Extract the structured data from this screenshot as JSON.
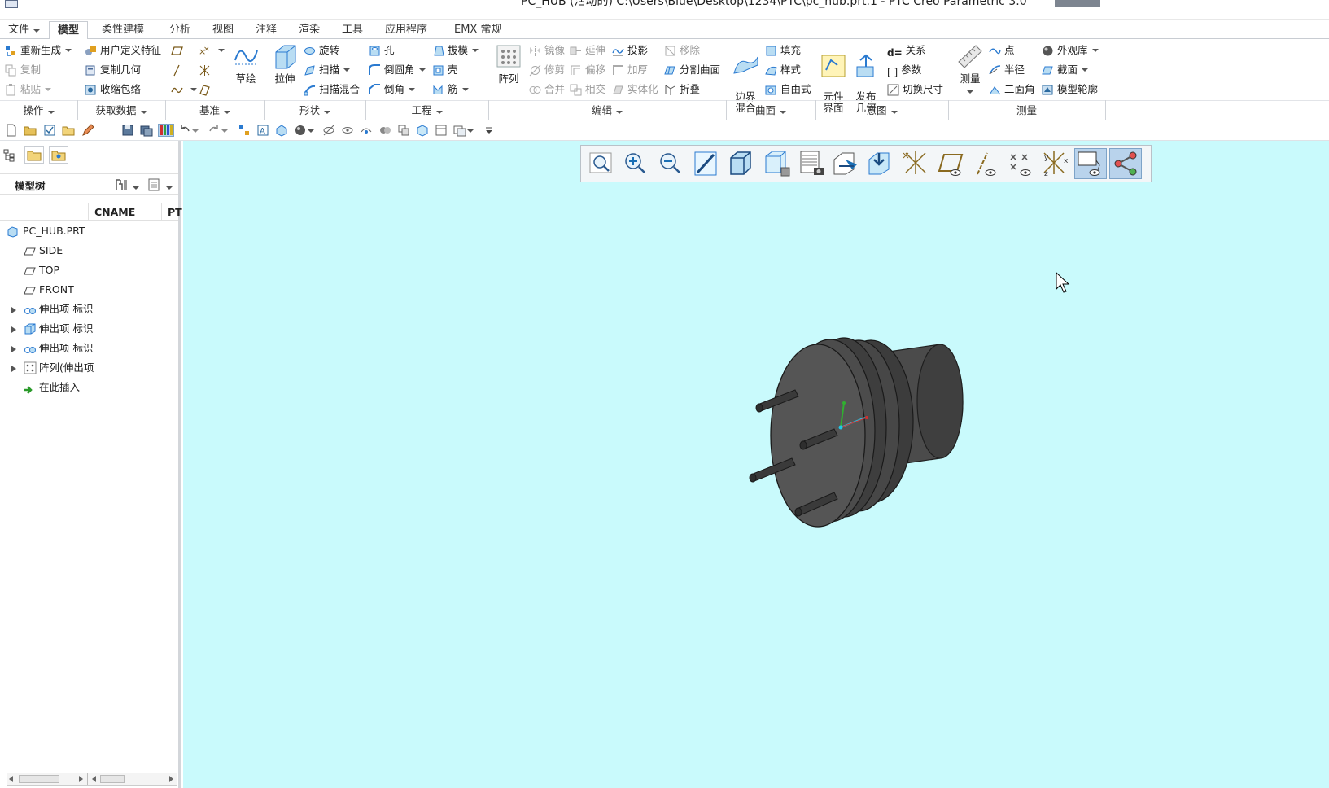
{
  "window": {
    "title": "PC_HUB (活动的) C:\\Users\\Blue\\Desktop\\1234\\PTC\\pc_hub.prt.1 - PTC Creo Parametric 3.0"
  },
  "tabs": [
    {
      "label": "文件"
    },
    {
      "label": "模型",
      "active": true
    },
    {
      "label": "柔性建模"
    },
    {
      "label": "分析"
    },
    {
      "label": "视图"
    },
    {
      "label": "注释"
    },
    {
      "label": "渲染"
    },
    {
      "label": "工具"
    },
    {
      "label": "应用程序"
    },
    {
      "label": "EMX 常规"
    }
  ],
  "ribbon": {
    "operations": {
      "regenerate": "重新生成",
      "copy": "复制",
      "paste": "粘贴",
      "label": "操作"
    },
    "get_data": {
      "udf": "用户定义特征",
      "copy_geom": "复制几何",
      "shrinkwrap": "收缩包络",
      "label": "获取数据"
    },
    "datum": {
      "sketch": "草绘",
      "label": "基准"
    },
    "shapes": {
      "extrude": "拉伸",
      "revolve": "旋转",
      "sweep": "扫描",
      "swept_blend": "扫描混合",
      "label": "形状"
    },
    "engineering": {
      "hole": "孔",
      "round": "倒圆角",
      "chamfer": "倒角",
      "draft": "拔模",
      "shell": "壳",
      "rib": "筋",
      "label": "工程"
    },
    "editing": {
      "pattern": "阵列",
      "mirror": "镜像",
      "trim": "修剪",
      "merge": "合并",
      "extend": "延伸",
      "offset": "偏移",
      "intersect": "相交",
      "project": "投影",
      "thicken": "加厚",
      "solidify": "实体化",
      "remove": "移除",
      "split_surface": "分割曲面",
      "fold": "折叠",
      "label": "编辑"
    },
    "surfaces": {
      "boundary_blend": "边界\n混合",
      "fill": "填充",
      "style": "样式",
      "freestyle": "自由式",
      "label": "曲面"
    },
    "intent": {
      "component_interface": "元件\n界面",
      "publish_geom": "发布\n几何",
      "relations": "关系",
      "parameters": "参数",
      "switch_dims": "切换尺寸",
      "label": "意图"
    },
    "measure": {
      "measure": "测量",
      "point": "点",
      "radius": "半径",
      "dihedral": "二面角",
      "appearance": "外观库",
      "section": "截面",
      "model_silhouette": "模型轮廓",
      "label": "测量"
    }
  },
  "left_panel": {
    "model_tree_label": "模型树",
    "columns": [
      "CNAME",
      "PT"
    ],
    "tree": [
      {
        "label": "PC_HUB.PRT",
        "icon": "part-icon",
        "expandable": false
      },
      {
        "label": "SIDE",
        "icon": "plane-icon",
        "expandable": false
      },
      {
        "label": "TOP",
        "icon": "plane-icon",
        "expandable": false
      },
      {
        "label": "FRONT",
        "icon": "plane-icon",
        "expandable": false
      },
      {
        "label": "伸出项 标识",
        "icon": "revolve-icon",
        "expandable": true
      },
      {
        "label": "伸出项 标识",
        "icon": "extrude-icon",
        "expandable": true
      },
      {
        "label": "伸出项 标识",
        "icon": "revolve-icon",
        "expandable": true
      },
      {
        "label": "阵列(伸出项",
        "icon": "pattern-icon",
        "expandable": true
      },
      {
        "label": "在此插入",
        "icon": "insert-arrow-icon",
        "expandable": false
      }
    ]
  },
  "view_toolbar": {
    "buttons": [
      "refit-icon",
      "zoom-in-icon",
      "zoom-out-icon",
      "repaint-icon",
      "display-style-icon",
      "saved-orientations-icon",
      "named-views-icon",
      "section-icon",
      "perspective-icon",
      "datum-display-icon",
      "plane-display-icon",
      "axis-display-icon",
      "point-display-icon",
      "csys-display-icon",
      "annotation-display-icon",
      "spin-center-icon"
    ],
    "active": [
      "annotation-display-icon",
      "spin-center-icon"
    ]
  },
  "colors": {
    "viewport_bg": "#c9fafc",
    "accent": "#1a6fb5",
    "model_fill": "#5a5a5a"
  }
}
